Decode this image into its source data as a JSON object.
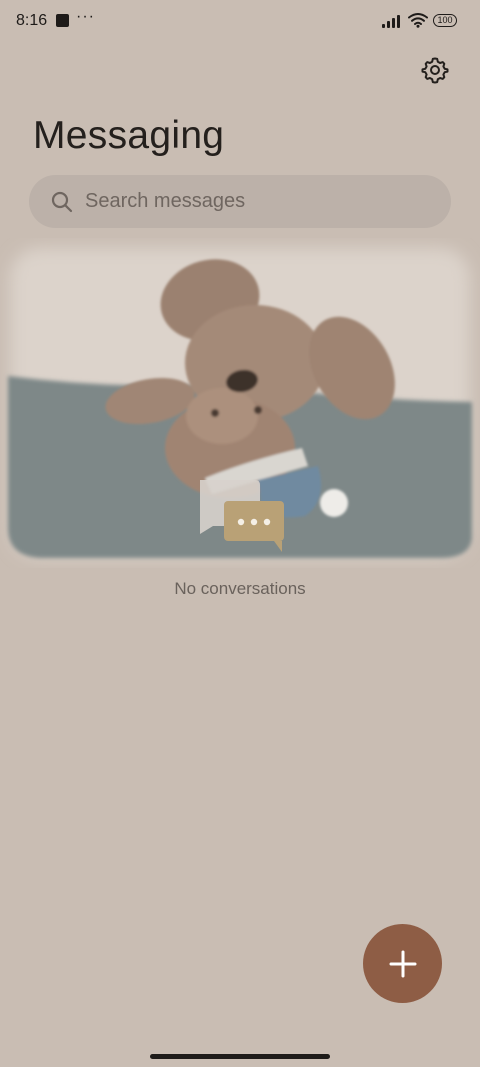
{
  "status_bar": {
    "time": "8:16",
    "overflow": "···",
    "battery": "100"
  },
  "header": {
    "title": "Messaging",
    "settings_icon": "gear-icon"
  },
  "search": {
    "placeholder": "Search messages",
    "icon": "search-icon"
  },
  "empty_state": {
    "message": "No conversations",
    "illustration": "plush-dog-illustration",
    "chat_icon": "chat-bubbles-icon"
  },
  "fab": {
    "icon": "plus-icon",
    "color": "#8e5d45"
  },
  "colors": {
    "background": "#c9bdb3",
    "search_bg": "#bcb1a9",
    "accent": "#8e5d45"
  }
}
